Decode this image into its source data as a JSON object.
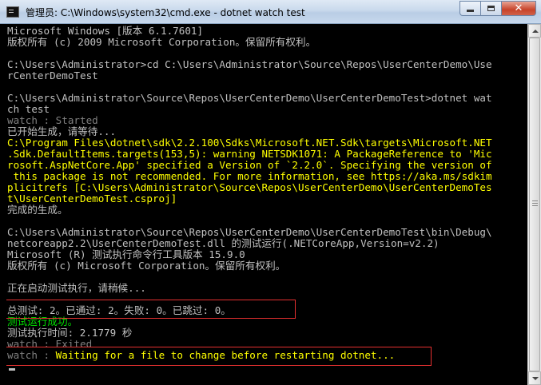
{
  "window": {
    "title": "管理员: C:\\Windows\\system32\\cmd.exe - dotnet  watch test",
    "close_glyph": "✕"
  },
  "console": {
    "lines": [
      {
        "text": "Microsoft Windows [版本 6.1.7601]",
        "color": "g"
      },
      {
        "text": "版权所有 (c) 2009 Microsoft Corporation。保留所有权利。",
        "color": "g"
      },
      {
        "text": "",
        "color": "g"
      },
      {
        "text": "C:\\Users\\Administrator>cd C:\\Users\\Administrator\\Source\\Repos\\UserCenterDemo\\Use",
        "color": "g"
      },
      {
        "text": "rCenterDemoTest",
        "color": "g"
      },
      {
        "text": "",
        "color": "g"
      },
      {
        "text": "C:\\Users\\Administrator\\Source\\Repos\\UserCenterDemo\\UserCenterDemoTest>dotnet wat",
        "color": "g"
      },
      {
        "text": "ch test",
        "color": "g"
      },
      {
        "text": "watch : Started",
        "color": "dk"
      },
      {
        "text": "已开始生成，请等待...",
        "color": "g"
      },
      {
        "text": "C:\\Program Files\\dotnet\\sdk\\2.2.100\\Sdks\\Microsoft.NET.Sdk\\targets\\Microsoft.NET",
        "color": "y"
      },
      {
        "text": ".Sdk.DefaultItems.targets(153,5): warning NETSDK1071: A PackageReference to 'Mic",
        "color": "y"
      },
      {
        "text": "rosoft.AspNetCore.App' specified a Version of `2.2.0`. Specifying the version of",
        "color": "y"
      },
      {
        "text": " this package is not recommended. For more information, see https://aka.ms/sdkim",
        "color": "y"
      },
      {
        "text": "plicitrefs [C:\\Users\\Administrator\\Source\\Repos\\UserCenterDemo\\UserCenterDemoTes",
        "color": "y"
      },
      {
        "text": "t\\UserCenterDemoTest.csproj]",
        "color": "y"
      },
      {
        "text": "完成的生成。",
        "color": "g"
      },
      {
        "text": "",
        "color": "g"
      },
      {
        "text": "C:\\Users\\Administrator\\Source\\Repos\\UserCenterDemo\\UserCenterDemoTest\\bin\\Debug\\",
        "color": "g"
      },
      {
        "text": "netcoreapp2.2\\UserCenterDemoTest.dll 的测试运行(.NETCoreApp,Version=v2.2)",
        "color": "g"
      },
      {
        "text": "Microsoft (R) 测试执行命令行工具版本 15.9.0",
        "color": "g"
      },
      {
        "text": "版权所有 (c) Microsoft Corporation。保留所有权利。",
        "color": "g"
      },
      {
        "text": "",
        "color": "g"
      },
      {
        "text": "正在启动测试执行，请稍候...",
        "color": "g"
      },
      {
        "text": "",
        "color": "g"
      },
      {
        "text": "总测试: 2。已通过: 2。失败: 0。已跳过: 0。",
        "color": "g"
      },
      {
        "text": "测试运行成功。",
        "color": "gr"
      },
      {
        "text": "测试执行时间: 2.1779 秒",
        "color": "g"
      },
      {
        "text": "watch : Exited",
        "color": "dk"
      },
      {
        "text": "watch : Waiting for a file to change before restarting dotnet...",
        "color": "y",
        "prefix": "watch : ",
        "prefix_color": "dk",
        "rest": "Waiting for a file to change before restarting dotnet..."
      }
    ]
  },
  "colors": {
    "console_bg": "#000000",
    "default_text": "#c0c0c0",
    "warning_text": "#ffff00",
    "success_text": "#00e000",
    "watch_text": "#808080",
    "highlight_border": "#e53030"
  }
}
